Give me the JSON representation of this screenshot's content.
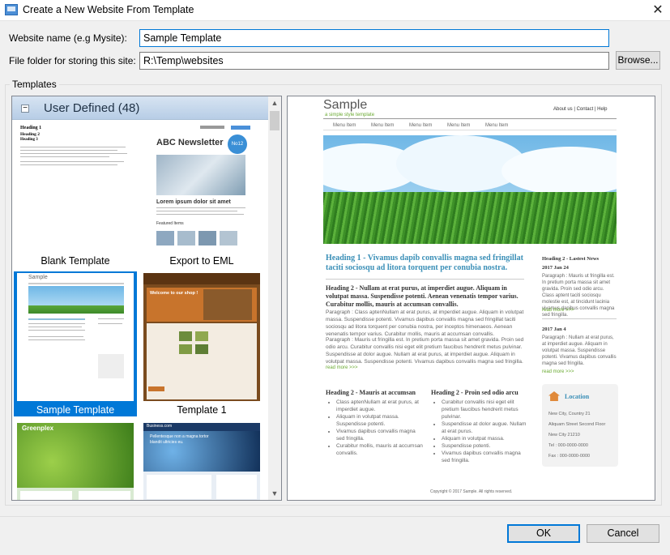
{
  "window": {
    "title": "Create a New Website From Template",
    "close_glyph": "✕"
  },
  "form": {
    "name_label": "Website name (e.g Mysite):",
    "name_value": "Sample Template",
    "folder_label": "File folder for storing this site:",
    "folder_value": "R:\\Temp\\websites",
    "browse_label": "Browse..."
  },
  "templates": {
    "group_label": "Templates",
    "category": "User Defined (48)",
    "items": [
      {
        "label": "Blank Template",
        "selected": false
      },
      {
        "label": "Export to EML",
        "selected": false
      },
      {
        "label": "Sample Template",
        "selected": true
      },
      {
        "label": "Template 1",
        "selected": false
      },
      {
        "label": "",
        "selected": false
      },
      {
        "label": "",
        "selected": false
      }
    ],
    "thumb_blank": {
      "h1": "Heading 1",
      "h2": "Heading 2",
      "h3": "Heading 3"
    },
    "thumb_eml": {
      "title": "ABC Newsletter",
      "badge": "No12",
      "lead": "Lorem ipsum dolor sit amet",
      "sub": "Featured Items"
    },
    "thumb_t1": {
      "banner": "Welcome to our shop !"
    },
    "thumb_green": {
      "brand": "Greenplex"
    },
    "thumb_blue": {
      "brand": "Business.com",
      "hero": "Pellentesque non a magna tortor blandit ultricies eu."
    }
  },
  "preview": {
    "logo": "Sample",
    "tagline": "a simple style template",
    "top_links": "About us | Contact | Help",
    "menu": [
      "Menu Item",
      "Menu Item",
      "Menu Item",
      "Menu Item",
      "Menu Item"
    ],
    "h1": "Heading 1 - Vivamus dapib convallis magna sed fringillat taciti sociosqu ad litora torquent per conubia nostra.",
    "h2a": "Heading 2 - Nullam at erat purus, at imperdiet augue. Aliquam in volutpat massa. Suspendisse potenti. Aenean venenatis tempor varius. Curabitur mollis, mauris at accumsan convallis.",
    "p1": "Paragraph : Class aptenNullam at erat purus, at imperdiet augue. Aliquam in volutpat massa. Suspendisse potenti. Vivamus dapibus convallis magna sed fringillat taciti sociosqu ad litora torquent per conubia nostra, per inceptos himenaeos. Aenean venenatis tempor varius. Curabitur mollis, mauris at accumsan convallis.",
    "p2": "Paragraph : Mauris ut fringilla est. In pretium porta massa sit amet gravida. Proin sed odio arcu. Curabitur convallis nisi eget elit pretium faucibus hendrerit metus pulvinar. Suspendisse at dolor augue. Nullam at erat purus, at imperdiet augue. Aliquam in volutpat massa. Suspendisse potenti. Vivamus dapibus convallis magna sed fringilla.",
    "read_more": "read more >>>",
    "h2b": "Heading 2 - Mauris at accumsan",
    "list_b": [
      "Class aptenNullam at erat purus, at imperdiet augue.",
      "Aliquam in volutpat massa. Suspendisse potenti.",
      "Vivamus dapibus convallis magna sed fringilla.",
      "Curabitur mollis, mauris at accumsan convallis."
    ],
    "h2c": "Heading 2 - Proin sed odio arcu",
    "list_c": [
      "Curabitur convallis nisi eget elit pretium faucibus hendrerit metus pulvinar.",
      "Suspendisse at dolor augue. Nullam at erat purus.",
      "Aliquam in volutpat massa.",
      "Suspendisse potenti.",
      "Vivamus dapibus convallis magna sed fringilla."
    ],
    "news_title": "Heading 2 - Lastest News",
    "news": [
      {
        "date": "2017 Jan 24",
        "text": "Paragraph : Mauris ut fringilla est. In pretium porta massa sit amet gravida. Proin sed odio arcu. Class aptent taciti sociosqu molestie est, at tincidunt lacinia vivamus dapibus convallis magna sed fringilla."
      },
      {
        "date": "2017 Jan 4",
        "text": "Paragraph : Nullam at erat purus, at imperdiet augue. Aliquam in volutpat massa. Suspendisse potenti. Vivamus dapibus convallis magna sed fringilla."
      }
    ],
    "location_title": "Location",
    "location_lines": [
      "New City, Country 21",
      "Aliquam Street Second Floor",
      "New City 21210",
      "Tel : 000-0000-0000",
      "Fax : 000-0000-0000"
    ],
    "copyright": "Copyright © 2017 Sample. All rights reserved."
  },
  "buttons": {
    "ok": "OK",
    "cancel": "Cancel"
  },
  "colors": {
    "accent": "#0078d7",
    "link_green": "#6aaa32",
    "heading_blue": "#3a8fb7"
  }
}
